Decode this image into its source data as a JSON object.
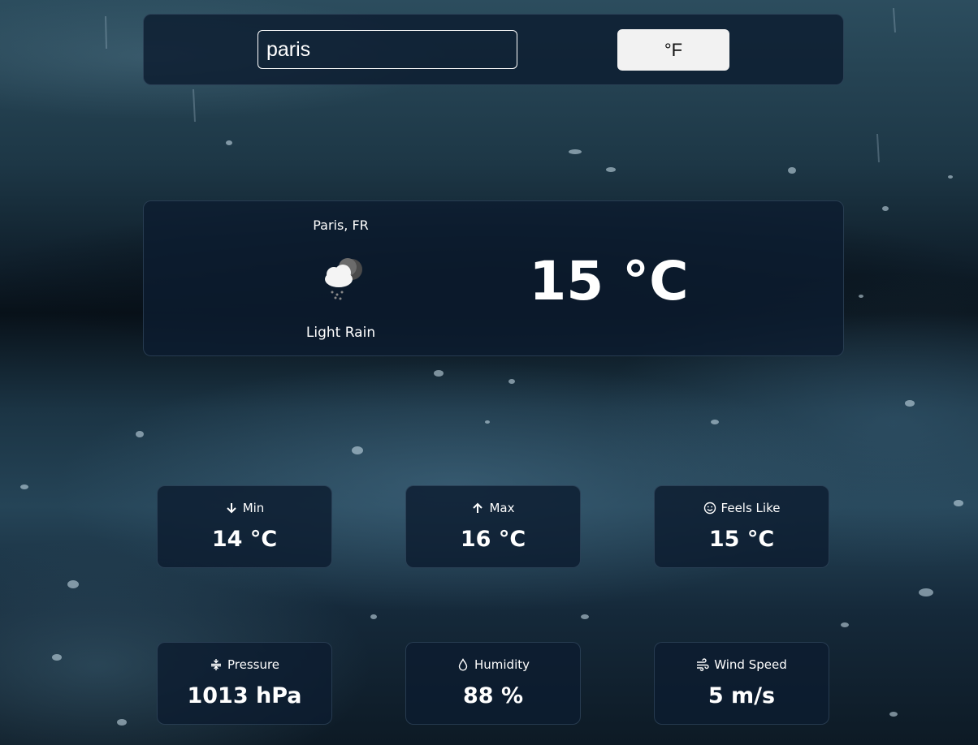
{
  "search": {
    "value": "paris"
  },
  "unit_toggle": {
    "label": "°F"
  },
  "current": {
    "location": "Paris, FR",
    "icon": "cloud-rain-moon-icon",
    "description": "Light Rain",
    "temperature": "15 °C"
  },
  "stats": [
    {
      "label": "Min",
      "value": "14 °C",
      "icon": "arrow-down-icon"
    },
    {
      "label": "Max",
      "value": "16 °C",
      "icon": "arrow-up-icon"
    },
    {
      "label": "Feels Like",
      "value": "15 °C",
      "icon": "smile-icon"
    },
    {
      "label": "Pressure",
      "value": "1013 hPa",
      "icon": "pressure-icon"
    },
    {
      "label": "Humidity",
      "value": "88 %",
      "icon": "droplet-icon"
    },
    {
      "label": "Wind Speed",
      "value": "5 m/s",
      "icon": "wind-icon"
    }
  ],
  "colors": {
    "panel": "#0c1c30",
    "button": "#f2f2f2",
    "text": "#ffffff"
  }
}
